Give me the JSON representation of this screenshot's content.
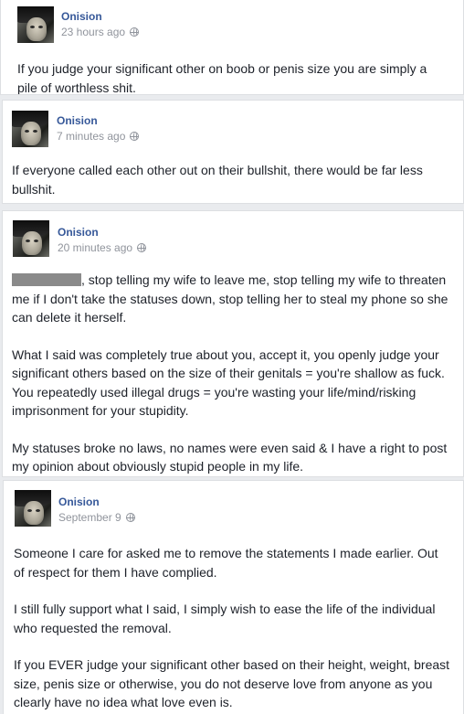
{
  "posts": [
    {
      "author": "Onision",
      "time": "23 hours ago",
      "privacy_icon": "globe-icon",
      "paragraphs": [
        "If you judge your significant other on boob or penis size you are simply a pile of worthless shit."
      ]
    },
    {
      "author": "Onision",
      "time": "7 minutes ago",
      "privacy_icon": "globe-icon",
      "paragraphs": [
        "If everyone called each other out on their bullshit, there would be far less bullshit."
      ]
    },
    {
      "author": "Onision",
      "time": "20 minutes ago",
      "privacy_icon": "globe-icon",
      "p1_rest": ", stop telling my wife to leave me, stop telling my wife to threaten me if I don't take the statuses down, stop telling her to steal my phone so she can delete it herself.",
      "p2": "What I said was completely true about you, accept it, you openly judge your significant others based on the size of their genitals = you're shallow as fuck. You repeatedly used illegal drugs = you're wasting your life/mind/risking imprisonment for your stupidity.",
      "p3": "My statuses broke no laws, no names were even said & I have a right to post my opinion about obviously stupid people in my life."
    },
    {
      "author": "Onision",
      "time": "September 9",
      "privacy_icon": "globe-icon",
      "p1": "Someone I care for asked me to remove the statements I made earlier. Out of respect for them I have complied.",
      "p2": "I still fully support what I said, I simply wish to ease the life of the individual who requested the removal.",
      "p3": "If you EVER judge your significant other based on their height, weight, breast size, penis size or otherwise, you do not deserve love from anyone as you clearly have no idea what love even is."
    }
  ]
}
